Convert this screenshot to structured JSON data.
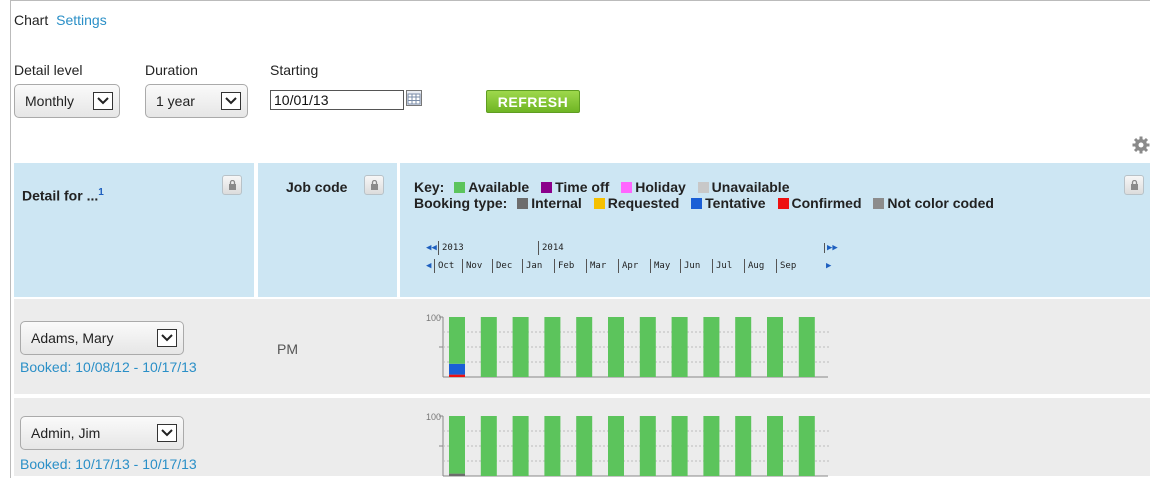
{
  "breadcrumb": {
    "current": "Chart",
    "link": "Settings"
  },
  "controls": {
    "detail_label": "Detail level",
    "detail_value": "Monthly",
    "duration_label": "Duration",
    "duration_value": "1 year",
    "starting_label": "Starting",
    "starting_value": "10/01/13",
    "refresh_label": "REFRESH"
  },
  "columns": {
    "detail_for": "Detail for ...",
    "detail_for_note": "1",
    "job_code": "Job code"
  },
  "key": {
    "key_label": "Key:",
    "availability": [
      {
        "label": "Available",
        "color": "#5cc45c"
      },
      {
        "label": "Time off",
        "color": "#8b008b"
      },
      {
        "label": "Holiday",
        "color": "#ff66ff"
      },
      {
        "label": "Unavailable",
        "color": "#c8c8c8"
      }
    ],
    "booking_label": "Booking type:",
    "booking_types": [
      {
        "label": "Internal",
        "color": "#6d6d6d"
      },
      {
        "label": "Requested",
        "color": "#f5c000"
      },
      {
        "label": "Tentative",
        "color": "#1a5fd6"
      },
      {
        "label": "Confirmed",
        "color": "#ee1111"
      },
      {
        "label": "Not color coded",
        "color": "#8c8c8c"
      }
    ]
  },
  "timeline": {
    "years": [
      "2013",
      "2014"
    ],
    "months": [
      "Oct",
      "Nov",
      "Dec",
      "Jan",
      "Feb",
      "Mar",
      "Apr",
      "May",
      "Jun",
      "Jul",
      "Aug",
      "Sep"
    ]
  },
  "rows": [
    {
      "name": "Adams, Mary",
      "booked": "Booked: 10/08/12 - 10/17/13",
      "job_code": "PM",
      "chart_max_label": "100",
      "bars": [
        {
          "available": 78,
          "tentative": 18,
          "confirmed": 4
        },
        {
          "available": 100
        },
        {
          "available": 100
        },
        {
          "available": 100
        },
        {
          "available": 100
        },
        {
          "available": 100
        },
        {
          "available": 100
        },
        {
          "available": 100
        },
        {
          "available": 100
        },
        {
          "available": 100
        },
        {
          "available": 100
        },
        {
          "available": 100
        }
      ]
    },
    {
      "name": "Admin, Jim",
      "booked": "Booked: 10/17/13 - 10/17/13",
      "job_code": "",
      "chart_max_label": "100",
      "bars": [
        {
          "available": 96,
          "internal": 4
        },
        {
          "available": 100
        },
        {
          "available": 100
        },
        {
          "available": 100
        },
        {
          "available": 100
        },
        {
          "available": 100
        },
        {
          "available": 100
        },
        {
          "available": 100
        },
        {
          "available": 100
        },
        {
          "available": 100
        },
        {
          "available": 100
        },
        {
          "available": 100
        }
      ]
    }
  ]
}
